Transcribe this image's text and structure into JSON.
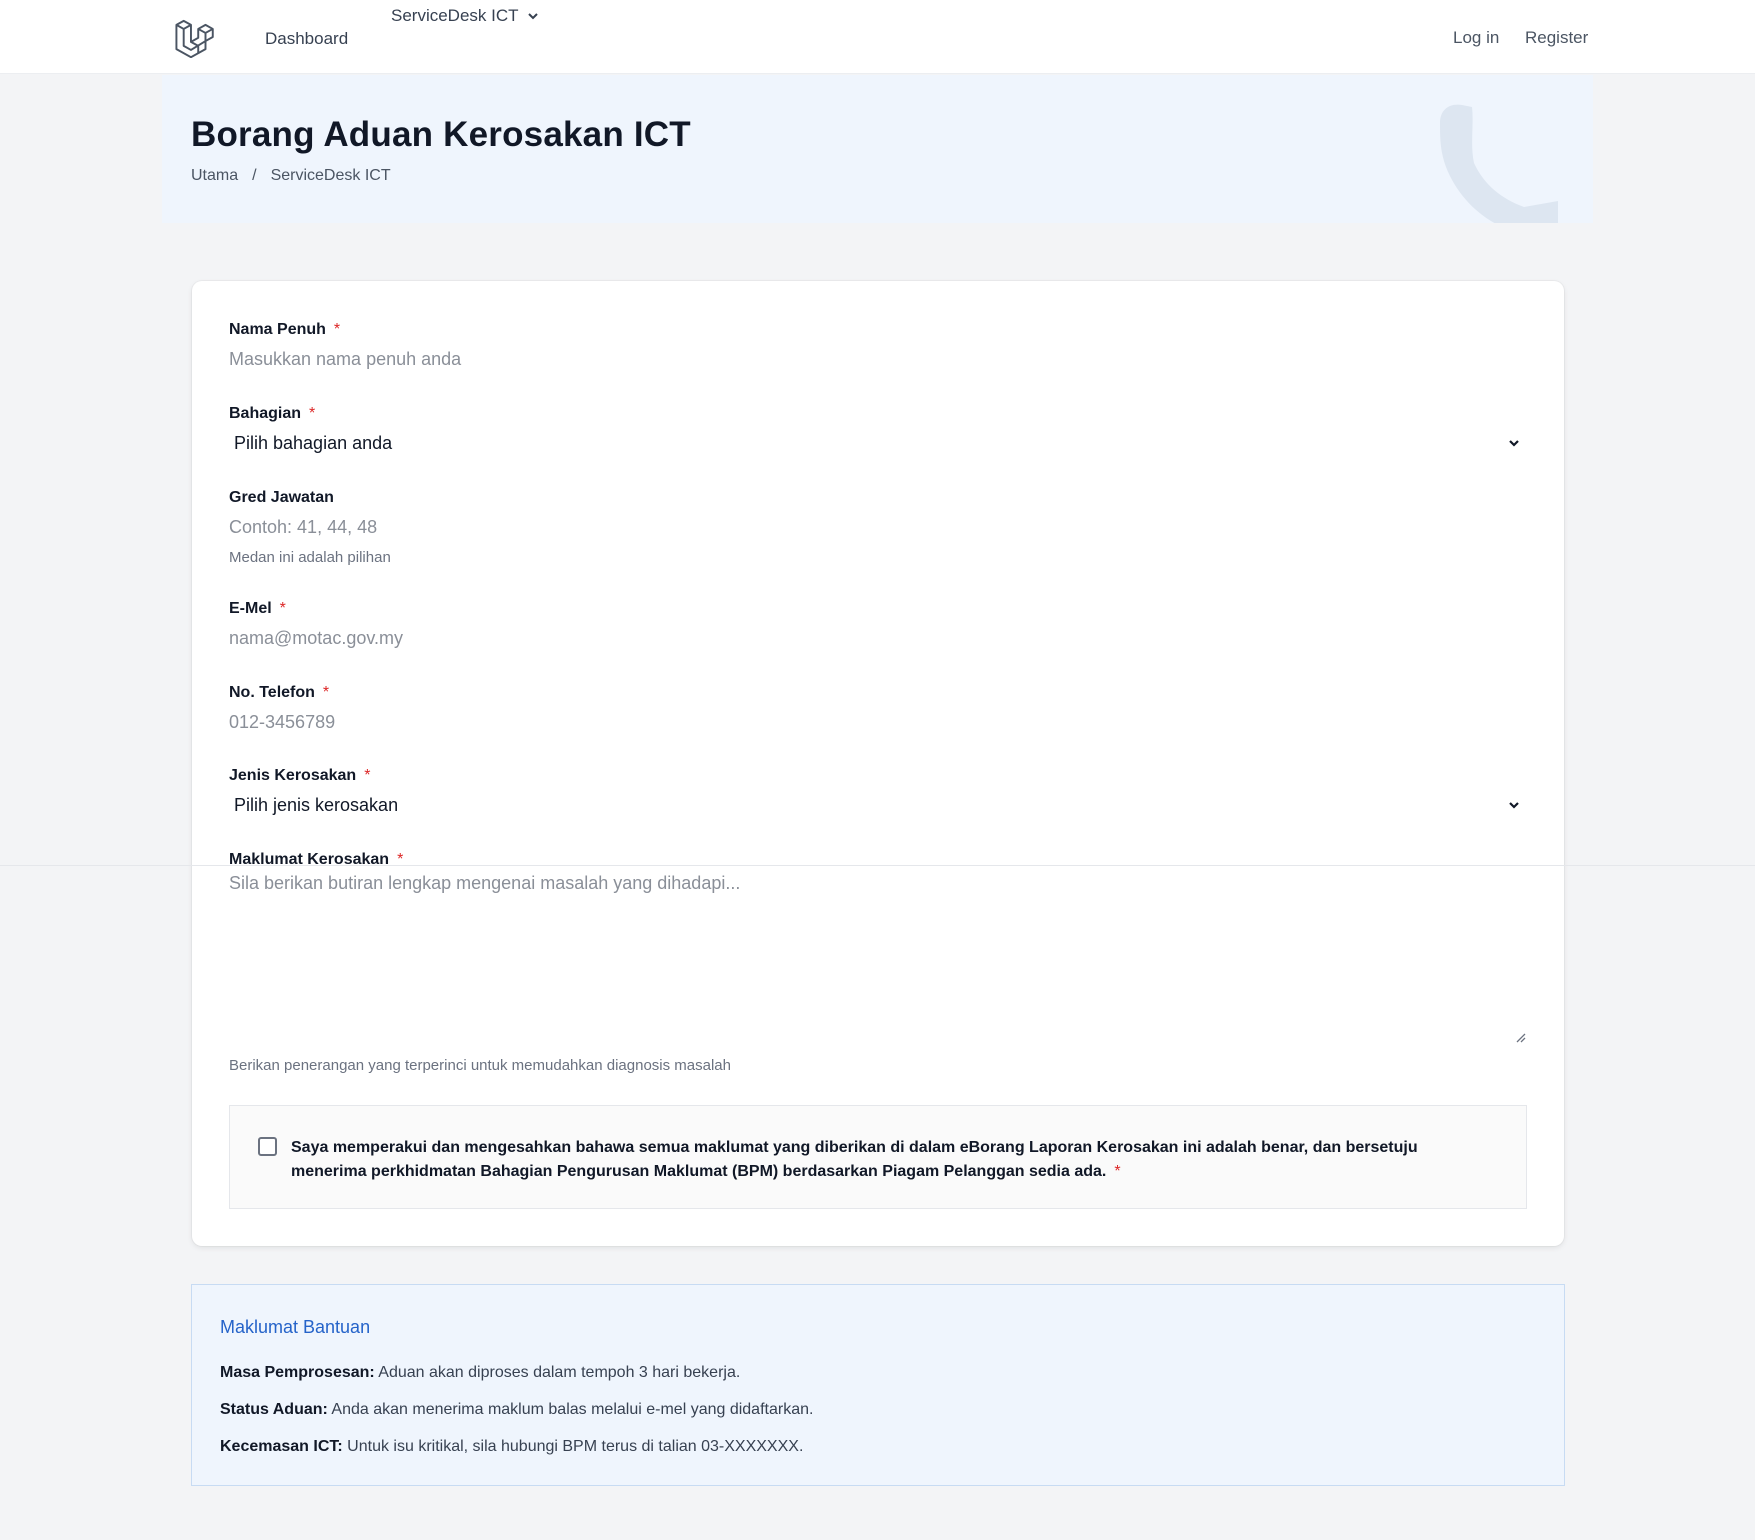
{
  "nav": {
    "dashboard": "Dashboard",
    "servicedesk": "ServiceDesk ICT",
    "login": "Log in",
    "register": "Register"
  },
  "header": {
    "title": "Borang Aduan Kerosakan ICT",
    "breadcrumb_home": "Utama",
    "breadcrumb_sep": "/",
    "breadcrumb_current": "ServiceDesk ICT"
  },
  "form": {
    "required_mark": "*",
    "nama": {
      "label": "Nama Penuh",
      "placeholder": "Masukkan nama penuh anda"
    },
    "bahagian": {
      "label": "Bahagian",
      "value": "Pilih bahagian anda"
    },
    "gred": {
      "label": "Gred Jawatan",
      "placeholder": "Contoh: 41, 44, 48",
      "help": "Medan ini adalah pilihan"
    },
    "emel": {
      "label": "E-Mel",
      "placeholder": "nama@motac.gov.my"
    },
    "telefon": {
      "label": "No. Telefon",
      "placeholder": "012-3456789"
    },
    "jenis": {
      "label": "Jenis Kerosakan",
      "value": "Pilih jenis kerosakan"
    },
    "maklumat": {
      "label": "Maklumat Kerosakan",
      "placeholder": "Sila berikan butiran lengkap mengenai masalah yang dihadapi...",
      "help": "Berikan penerangan yang terperinci untuk memudahkan diagnosis masalah"
    },
    "consent": "Saya memperakui dan mengesahkan bahawa semua maklumat yang diberikan di dalam eBorang Laporan Kerosakan ini adalah benar, dan bersetuju menerima perkhidmatan Bahagian Pengurusan Maklumat (BPM) berdasarkan Piagam Pelanggan sedia ada."
  },
  "help": {
    "title": "Maklumat Bantuan",
    "lines": [
      {
        "label": "Masa Pemprosesan:",
        "text": "Aduan akan diproses dalam tempoh 3 hari bekerja."
      },
      {
        "label": "Status Aduan:",
        "text": "Anda akan menerima maklum balas melalui e-mel yang didaftarkan."
      },
      {
        "label": "Kecemasan ICT:",
        "text": "Untuk isu kritikal, sila hubungi BPM terus di talian 03-XXXXXXX."
      }
    ]
  },
  "colors": {
    "accent": "#2563c9",
    "required": "#dc2626",
    "banner_bg": "#eff5fd"
  },
  "icons": [
    "laravel-logo-icon",
    "chevron-down-icon",
    "phone-icon",
    "resize-grip-icon"
  ]
}
